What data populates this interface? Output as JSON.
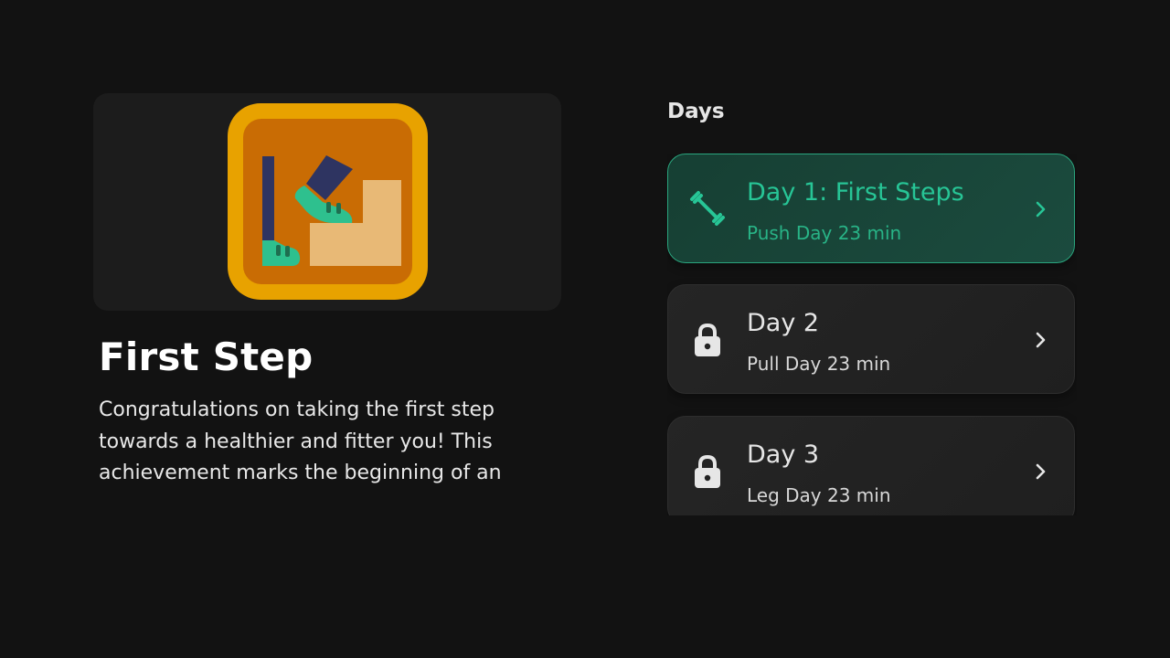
{
  "achievement": {
    "title": "First Step",
    "description": "Congratulations on taking the first step towards a healthier and fitter you! This achievement marks the beginning of an",
    "badge_icon": "foot-on-step-badge-icon"
  },
  "days": {
    "header": "Days",
    "items": [
      {
        "title": "Day 1: First Steps",
        "subtitle": "Push Day 23 min",
        "icon": "dumbbell-icon",
        "state": "unlocked",
        "accent": "#27c596"
      },
      {
        "title": "Day 2",
        "subtitle": "Pull Day 23 min",
        "icon": "lock-icon",
        "state": "locked"
      },
      {
        "title": "Day 3",
        "subtitle": "Leg Day 23 min",
        "icon": "lock-icon",
        "state": "locked"
      }
    ]
  },
  "colors": {
    "background": "#121212",
    "card": "#1c1c1c",
    "accent": "#27c596",
    "badge_outer": "#e8a200",
    "badge_inner": "#c96c04"
  }
}
